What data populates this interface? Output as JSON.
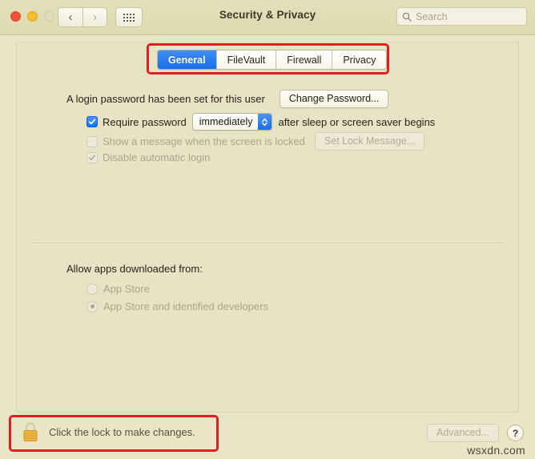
{
  "window": {
    "title": "Security & Privacy",
    "traffic_lights": [
      "close",
      "minimize",
      "zoom"
    ],
    "nav": {
      "back": "‹",
      "forward": "›",
      "grid": "grid-view"
    },
    "search": {
      "placeholder": "Search",
      "value": ""
    }
  },
  "tabs": [
    {
      "label": "General",
      "active": true
    },
    {
      "label": "FileVault",
      "active": false
    },
    {
      "label": "Firewall",
      "active": false
    },
    {
      "label": "Privacy",
      "active": false
    }
  ],
  "general": {
    "login_password_text": "A login password has been set for this user",
    "change_password_button": "Change Password...",
    "require_password": {
      "label": "Require password",
      "checked": true,
      "interval_value": "immediately",
      "suffix": "after sleep or screen saver begins"
    },
    "show_message": {
      "label": "Show a message when the screen is locked",
      "checked": false,
      "disabled": true,
      "button": "Set Lock Message..."
    },
    "disable_auto_login": {
      "label": "Disable automatic login",
      "checked": true,
      "disabled": true
    },
    "allow_apps": {
      "heading": "Allow apps downloaded from:",
      "options": [
        {
          "label": "App Store",
          "selected": false
        },
        {
          "label": "App Store and identified developers",
          "selected": true
        }
      ]
    }
  },
  "footer": {
    "lock_text": "Click the lock to make changes.",
    "lock_state": "locked",
    "advanced_button": "Advanced...",
    "help_button": "?"
  },
  "annotations": [
    {
      "name": "tabs-highlight",
      "color": "#e02020"
    },
    {
      "name": "lock-highlight",
      "color": "#e02020"
    }
  ],
  "watermark": "wsxdn.com"
}
